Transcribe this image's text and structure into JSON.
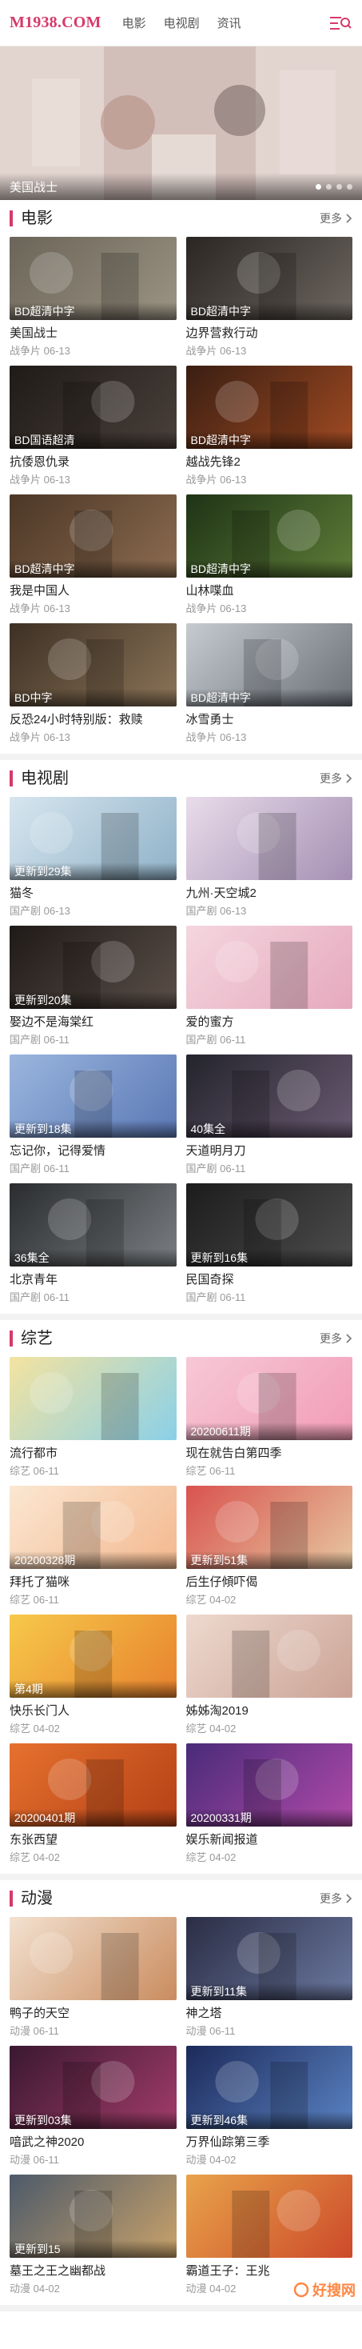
{
  "header": {
    "logo": "M1938.COM",
    "nav": [
      "电影",
      "电视剧",
      "资讯"
    ]
  },
  "banner": {
    "caption": "美国战士"
  },
  "sections": [
    {
      "title": "电影",
      "more": "更多",
      "items": [
        {
          "title": "美国战士",
          "meta": "战争片 06-13",
          "badge": "BD超清中字",
          "colors": [
            "#6b6458",
            "#9b9484"
          ]
        },
        {
          "title": "边界营救行动",
          "meta": "战争片 06-13",
          "badge": "BD超清中字",
          "colors": [
            "#2a2623",
            "#6d6660"
          ]
        },
        {
          "title": "抗倭恩仇录",
          "meta": "战争片 06-13",
          "badge": "BD国语超清",
          "colors": [
            "#1f1b18",
            "#4a403a"
          ]
        },
        {
          "title": "越战先锋2",
          "meta": "战争片 06-13",
          "badge": "BD超清中字",
          "colors": [
            "#3a1e12",
            "#a04a22"
          ]
        },
        {
          "title": "我是中国人",
          "meta": "战争片 06-13",
          "badge": "BD超清中字",
          "colors": [
            "#4b3626",
            "#8c6c50"
          ]
        },
        {
          "title": "山林喋血",
          "meta": "战争片 06-13",
          "badge": "BD超清中字",
          "colors": [
            "#1e3316",
            "#5f7d38"
          ]
        },
        {
          "title": "反恐24小时特别版：救赎",
          "meta": "战争片 06-13",
          "badge": "BD中字",
          "colors": [
            "#3d3024",
            "#8b7458"
          ]
        },
        {
          "title": "冰雪勇士",
          "meta": "战争片 06-13",
          "badge": "BD超清中字",
          "colors": [
            "#c6cbd0",
            "#6b7078"
          ]
        }
      ]
    },
    {
      "title": "电视剧",
      "more": "更多",
      "items": [
        {
          "title": "猫冬",
          "meta": "国产剧 06-13",
          "badge": "更新到29集",
          "colors": [
            "#d7e6ef",
            "#8fb1c8"
          ]
        },
        {
          "title": "九州·天空城2",
          "meta": "国产剧 06-13",
          "badge": "",
          "colors": [
            "#e9dcea",
            "#a48fb3"
          ]
        },
        {
          "title": "娶边不是海棠红",
          "meta": "国产剧 06-11",
          "badge": "更新到20集",
          "colors": [
            "#1f1a18",
            "#5b4f48"
          ]
        },
        {
          "title": "爱的蜜方",
          "meta": "国产剧 06-11",
          "badge": "",
          "colors": [
            "#f4d6df",
            "#e6a9bd"
          ]
        },
        {
          "title": "忘记你，记得爱情",
          "meta": "国产剧 06-11",
          "badge": "更新到18集",
          "colors": [
            "#9ab6de",
            "#5a77b5"
          ]
        },
        {
          "title": "天道明月刀",
          "meta": "国产剧 06-11",
          "badge": "40集全",
          "colors": [
            "#23242c",
            "#6a5a72"
          ]
        },
        {
          "title": "北京青年",
          "meta": "国产剧 06-11",
          "badge": "36集全",
          "colors": [
            "#2a2c2e",
            "#7a7e82"
          ]
        },
        {
          "title": "民国奇探",
          "meta": "国产剧 06-11",
          "badge": "更新到16集",
          "colors": [
            "#1c1c1c",
            "#4d4d4d"
          ]
        }
      ]
    },
    {
      "title": "综艺",
      "more": "更多",
      "items": [
        {
          "title": "流行都市",
          "meta": "综艺 06-11",
          "badge": "",
          "colors": [
            "#f4e3a0",
            "#8ad0e8"
          ]
        },
        {
          "title": "现在就告白第四季",
          "meta": "综艺 06-11",
          "badge": "20200611期",
          "colors": [
            "#f6c8d6",
            "#f29cb7"
          ]
        },
        {
          "title": "拜托了猫咪",
          "meta": "综艺 06-11",
          "badge": "20200328期",
          "colors": [
            "#fbe7d2",
            "#f3b88e"
          ]
        },
        {
          "title": "后生仔傾吓偈",
          "meta": "综艺 04-02",
          "badge": "更新到51集",
          "colors": [
            "#d9534f",
            "#e6c7a0"
          ]
        },
        {
          "title": "快乐长门人",
          "meta": "综艺 04-02",
          "badge": "第4期",
          "colors": [
            "#f7c94a",
            "#e7812d"
          ]
        },
        {
          "title": "姊姊淘2019",
          "meta": "综艺 04-02",
          "badge": "",
          "colors": [
            "#eed9cf",
            "#cba395"
          ]
        },
        {
          "title": "东张西望",
          "meta": "综艺 04-02",
          "badge": "20200401期",
          "colors": [
            "#e6712e",
            "#b44016"
          ]
        },
        {
          "title": "娱乐新闻报道",
          "meta": "综艺 04-02",
          "badge": "20200331期",
          "colors": [
            "#4a2b7a",
            "#b04aa8"
          ]
        }
      ]
    },
    {
      "title": "动漫",
      "more": "更多",
      "items": [
        {
          "title": "鸭子的天空",
          "meta": "动漫 06-11",
          "badge": "",
          "colors": [
            "#f3e1d0",
            "#c98c5f"
          ]
        },
        {
          "title": "神之塔",
          "meta": "动漫 06-11",
          "badge": "更新到11集",
          "colors": [
            "#2a2d44",
            "#6b78a0"
          ]
        },
        {
          "title": "喑武之神2020",
          "meta": "动漫 06-11",
          "badge": "更新到03集",
          "colors": [
            "#3a1830",
            "#a23c6a"
          ]
        },
        {
          "title": "万界仙踪第三季",
          "meta": "动漫 04-02",
          "badge": "更新到46集",
          "colors": [
            "#1c2a5a",
            "#5a82c2"
          ]
        },
        {
          "title": "墓王之王之幽都战",
          "meta": "动漫 04-02",
          "badge": "更新到15",
          "colors": [
            "#4d5a6a",
            "#c9a26a"
          ]
        },
        {
          "title": "霸道王子：王兆",
          "meta": "动漫 04-02",
          "badge": "",
          "colors": [
            "#e8a34a",
            "#cc4a2a"
          ]
        }
      ]
    }
  ],
  "watermark": "好搜网"
}
